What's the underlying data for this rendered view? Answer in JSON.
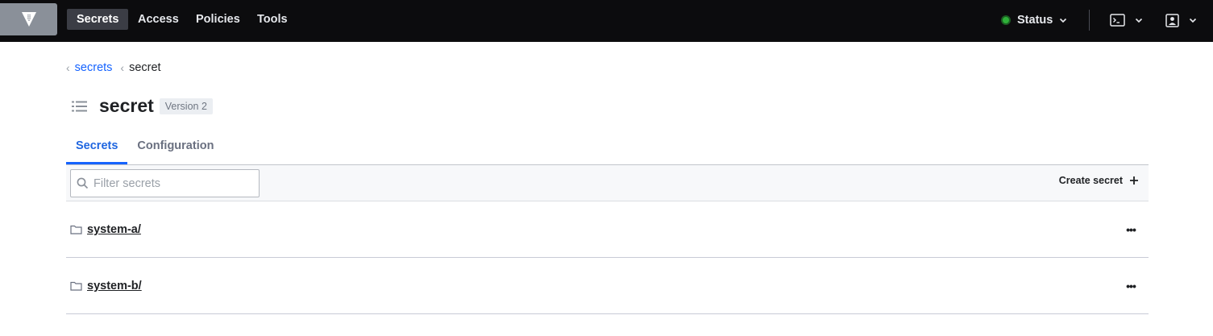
{
  "nav": {
    "links": [
      {
        "label": "Secrets",
        "active": true
      },
      {
        "label": "Access",
        "active": false
      },
      {
        "label": "Policies",
        "active": false
      },
      {
        "label": "Tools",
        "active": false
      }
    ],
    "status_label": "Status",
    "status_color": "#2eb039"
  },
  "breadcrumb": {
    "parent": "secrets",
    "current": "secret"
  },
  "page": {
    "title": "secret",
    "version_badge": "Version 2"
  },
  "tabs": [
    {
      "label": "Secrets",
      "active": true
    },
    {
      "label": "Configuration",
      "active": false
    }
  ],
  "toolbar": {
    "filter_placeholder": "Filter secrets",
    "create_label": "Create secret"
  },
  "items": [
    {
      "name": "system-a/"
    },
    {
      "name": "system-b/"
    }
  ],
  "colors": {
    "accent": "#1563ff",
    "nav_bg": "#0c0c0e"
  }
}
